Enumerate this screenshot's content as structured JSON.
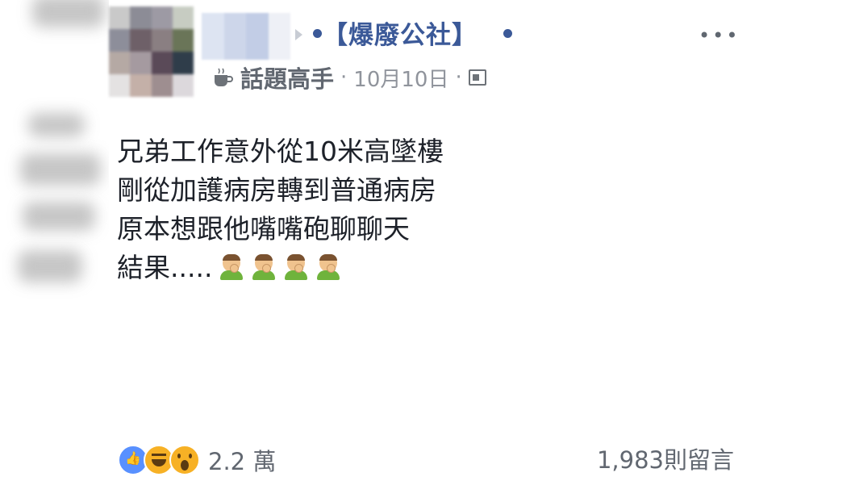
{
  "post": {
    "group_name": "【爆廢公社】",
    "tag": "話題高手",
    "separator": "·",
    "date": "10月10日",
    "more_label": "•••",
    "lines": [
      "兄弟工作意外從10米高墜樓",
      "剛從加護病房轉到普通病房",
      "原本想跟他嘴嘴砲聊聊天",
      "結果....."
    ],
    "emoji_names": [
      "man-facepalming-icon",
      "man-facepalming-icon",
      "man-facepalming-icon",
      "man-facepalming-icon"
    ]
  },
  "footer": {
    "reaction_icons": [
      "like-icon",
      "haha-icon",
      "wow-icon"
    ],
    "reaction_count": "2.2 萬",
    "comment_count": "1,983則留言"
  },
  "colors": {
    "link_blue": "#3b5998",
    "meta_gray": "#616770",
    "like_blue": "#5890ff",
    "reaction_yellow": "#f7b125"
  }
}
